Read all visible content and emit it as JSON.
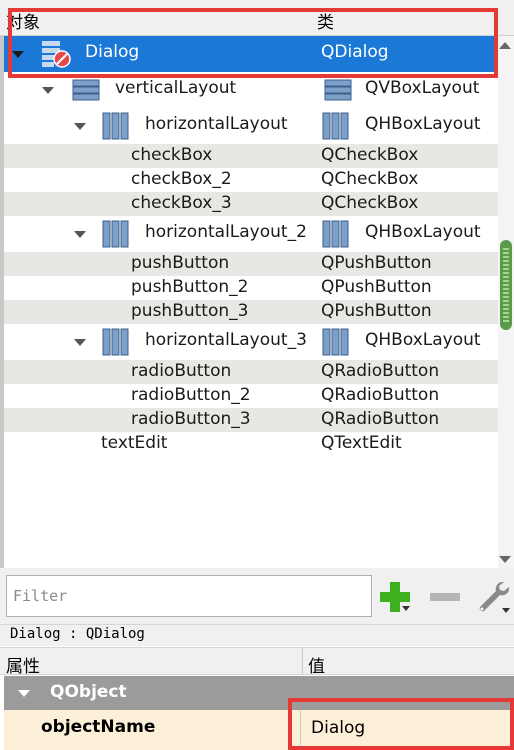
{
  "object_inspector": {
    "headers": {
      "object": "对象",
      "class": "类"
    },
    "rows": [
      {
        "name": "Dialog",
        "class": "QDialog",
        "selected": true
      },
      {
        "name": "verticalLayout",
        "class": "QVBoxLayout"
      },
      {
        "name": "horizontalLayout",
        "class": "QHBoxLayout"
      },
      {
        "name": "checkBox",
        "class": "QCheckBox"
      },
      {
        "name": "checkBox_2",
        "class": "QCheckBox"
      },
      {
        "name": "checkBox_3",
        "class": "QCheckBox"
      },
      {
        "name": "horizontalLayout_2",
        "class": "QHBoxLayout"
      },
      {
        "name": "pushButton",
        "class": "QPushButton"
      },
      {
        "name": "pushButton_2",
        "class": "QPushButton"
      },
      {
        "name": "pushButton_3",
        "class": "QPushButton"
      },
      {
        "name": "horizontalLayout_3",
        "class": "QHBoxLayout"
      },
      {
        "name": "radioButton",
        "class": "QRadioButton"
      },
      {
        "name": "radioButton_2",
        "class": "QRadioButton"
      },
      {
        "name": "radioButton_3",
        "class": "QRadioButton"
      },
      {
        "name": "textEdit",
        "class": "QTextEdit"
      }
    ]
  },
  "filter": {
    "placeholder": "Filter"
  },
  "property_editor": {
    "status": "Dialog : QDialog",
    "headers": {
      "property": "属性",
      "value": "值"
    },
    "group": "QObject",
    "row": {
      "name": "objectName",
      "value": "Dialog"
    }
  },
  "colors": {
    "selection": "#1b78d6",
    "highlight_box": "#e53935",
    "add_icon": "#3cb01e"
  }
}
